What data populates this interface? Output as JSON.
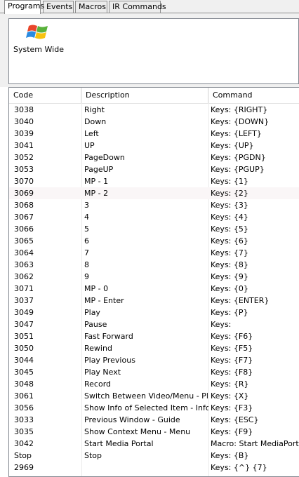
{
  "tabs": [
    {
      "label": "Programs",
      "active": true
    },
    {
      "label": "Events",
      "active": false
    },
    {
      "label": "Macros",
      "active": false
    },
    {
      "label": "IR Commands",
      "active": false
    }
  ],
  "program": {
    "label": "System Wide",
    "icon": "windows-logo-icon"
  },
  "columns": [
    "Code",
    "Description",
    "Command"
  ],
  "rows": [
    {
      "code": "3038",
      "desc": "Right",
      "cmd": "Keys: {RIGHT}"
    },
    {
      "code": "3040",
      "desc": "Down",
      "cmd": "Keys: {DOWN}"
    },
    {
      "code": "3039",
      "desc": "Left",
      "cmd": "Keys: {LEFT}"
    },
    {
      "code": "3041",
      "desc": "UP",
      "cmd": "Keys: {UP}"
    },
    {
      "code": "3052",
      "desc": "PageDown",
      "cmd": "Keys: {PGDN}"
    },
    {
      "code": "3053",
      "desc": "PageUP",
      "cmd": "Keys: {PGUP}"
    },
    {
      "code": "3070",
      "desc": "MP - 1",
      "cmd": "Keys: {1}"
    },
    {
      "code": "3069",
      "desc": "MP - 2",
      "cmd": "Keys: {2}",
      "highlight": true
    },
    {
      "code": "3068",
      "desc": "3",
      "cmd": "Keys: {3}"
    },
    {
      "code": "3067",
      "desc": "4",
      "cmd": "Keys: {4}"
    },
    {
      "code": "3066",
      "desc": "5",
      "cmd": "Keys: {5}"
    },
    {
      "code": "3065",
      "desc": "6",
      "cmd": "Keys: {6}"
    },
    {
      "code": "3064",
      "desc": "7",
      "cmd": "Keys: {7}"
    },
    {
      "code": "3063",
      "desc": "8",
      "cmd": "Keys: {8}"
    },
    {
      "code": "3062",
      "desc": "9",
      "cmd": "Keys: {9}"
    },
    {
      "code": "3071",
      "desc": "MP - 0",
      "cmd": "Keys: {0}"
    },
    {
      "code": "3037",
      "desc": "MP - Enter",
      "cmd": "Keys: {ENTER}"
    },
    {
      "code": "3049",
      "desc": "Play",
      "cmd": "Keys: {P}"
    },
    {
      "code": "3047",
      "desc": "Pause",
      "cmd": "Keys:"
    },
    {
      "code": "3051",
      "desc": "Fast Forward",
      "cmd": "Keys: {F6}"
    },
    {
      "code": "3050",
      "desc": "Rewind",
      "cmd": "Keys: {F5}"
    },
    {
      "code": "3044",
      "desc": "Play Previous",
      "cmd": "Keys: {F7}"
    },
    {
      "code": "3045",
      "desc": "Play Next",
      "cmd": "Keys: {F8}"
    },
    {
      "code": "3048",
      "desc": "Record",
      "cmd": "Keys: {R}"
    },
    {
      "code": "3061",
      "desc": "Switch Between Video/Menu - Pl...",
      "cmd": "Keys: {X}"
    },
    {
      "code": "3056",
      "desc": "Show Info of Selected Item - Info",
      "cmd": "Keys: {F3}"
    },
    {
      "code": "3033",
      "desc": "Previous Window - Guide",
      "cmd": "Keys: {ESC}"
    },
    {
      "code": "3035",
      "desc": "Show Context Menu - Menu",
      "cmd": "Keys: {F9}"
    },
    {
      "code": "3042",
      "desc": "Start Media Portal",
      "cmd": "Macro: Start MediaPortal"
    },
    {
      "code": "Stop",
      "desc": "Stop",
      "cmd": "Keys: {B}"
    },
    {
      "code": "2969",
      "desc": "",
      "cmd": "Keys: {^} {7}"
    }
  ]
}
